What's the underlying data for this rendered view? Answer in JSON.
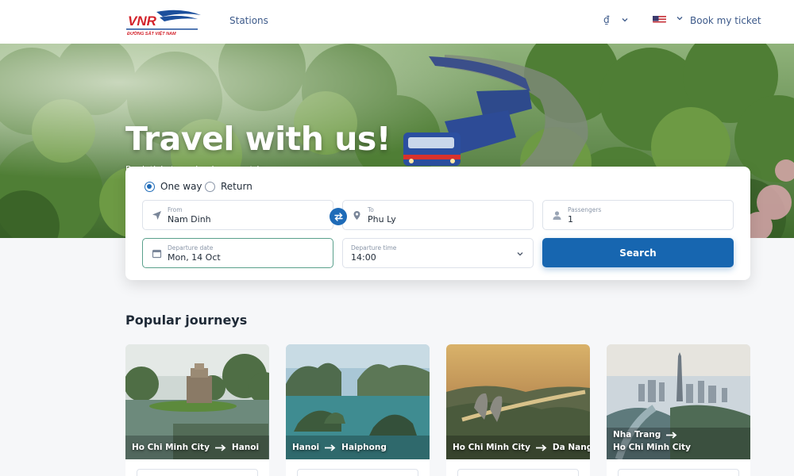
{
  "header": {
    "logo_text": "VNR",
    "logo_subtext": "ĐƯỜNG SẮT VIỆT NAM",
    "nav_stations": "Stations",
    "currency": "₫",
    "language_flag": "us-flag",
    "book_link": "Book my ticket"
  },
  "hero": {
    "title": "Travel with us!",
    "subtitle": "Book tickets and enjoy your trip"
  },
  "search": {
    "trip_type": {
      "one_way": "One way",
      "return": "Return",
      "selected": "one_way"
    },
    "from": {
      "label": "From",
      "value": "Nam Dinh"
    },
    "to": {
      "label": "To",
      "value": "Phu Ly"
    },
    "passengers": {
      "label": "Passengers",
      "value": "1"
    },
    "departure_date": {
      "label": "Departure date",
      "value": "Mon, 14 Oct"
    },
    "departure_time": {
      "label": "Departure time",
      "value": "14:00"
    },
    "search_button": "Search"
  },
  "popular": {
    "title": "Popular journeys",
    "cards": [
      {
        "from": "Ho Chi Minh City",
        "to": "Hanoi"
      },
      {
        "from": "Hanoi",
        "to": "Haiphong"
      },
      {
        "from": "Ho Chi Minh City",
        "to": "Da Nang"
      },
      {
        "from": "Nha Trang",
        "to": "Ho Chi Minh City"
      }
    ]
  },
  "colors": {
    "primary": "#1766b0",
    "nav_text": "#3d5a8a",
    "logo_red": "#d3222a",
    "logo_blue": "#1c4f9c"
  }
}
